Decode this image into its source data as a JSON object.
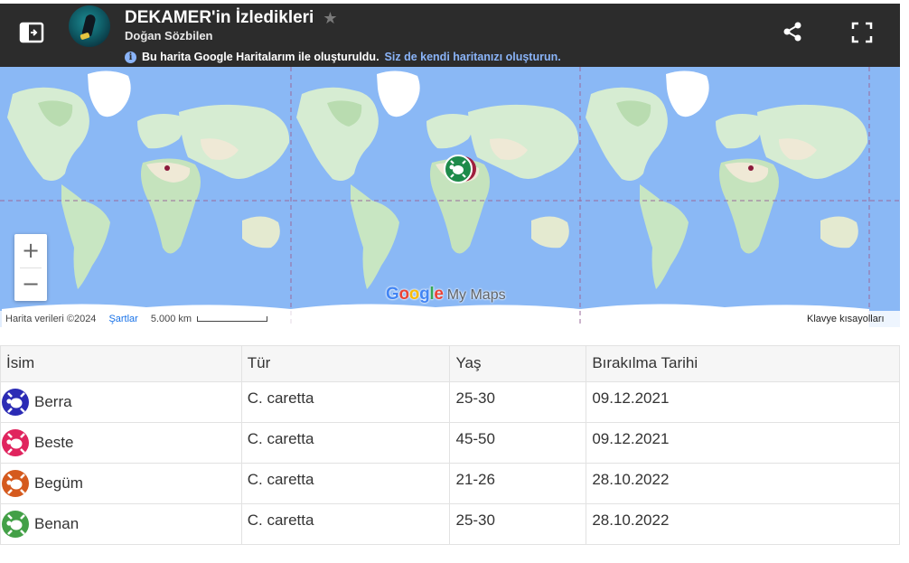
{
  "header": {
    "title": "DEKAMER'in İzledikleri",
    "author": "Doğan Sözbilen",
    "notice_text": "Bu harita Google Haritalarım ile oluşturuldu.",
    "notice_link": "Siz de kendi haritanızı oluşturun.",
    "icons": [
      "sidebar-toggle-icon",
      "star-icon",
      "info-icon",
      "share-icon",
      "fullscreen-icon"
    ]
  },
  "map": {
    "logo_google": "Google",
    "logo_mymaps": "My Maps",
    "attribution": "Harita verileri ©2024",
    "terms": "Şartlar",
    "scale": "5.000 km",
    "keyboard_shortcuts": "Klavye kısayolları",
    "zoom_in": "+",
    "zoom_out": "−",
    "colors": {
      "water": "#8ab8f5",
      "land": "#d6ecd2",
      "ice": "#ffffff",
      "marker": "#1e8a4a"
    }
  },
  "table": {
    "headers": [
      "İsim",
      "Tür",
      "Yaş",
      "Bırakılma Tarihi"
    ],
    "rows": [
      {
        "name": "Berra",
        "species": "C. caretta",
        "age": "25-30",
        "date": "09.12.2021",
        "color": "#2b2bb5"
      },
      {
        "name": "Beste",
        "species": "C. caretta",
        "age": "45-50",
        "date": "09.12.2021",
        "color": "#e0245e"
      },
      {
        "name": "Begüm",
        "species": "C. caretta",
        "age": "21-26",
        "date": "28.10.2022",
        "color": "#d55a1e"
      },
      {
        "name": "Benan",
        "species": "C. caretta",
        "age": "25-30",
        "date": "28.10.2022",
        "color": "#43a047"
      }
    ]
  }
}
